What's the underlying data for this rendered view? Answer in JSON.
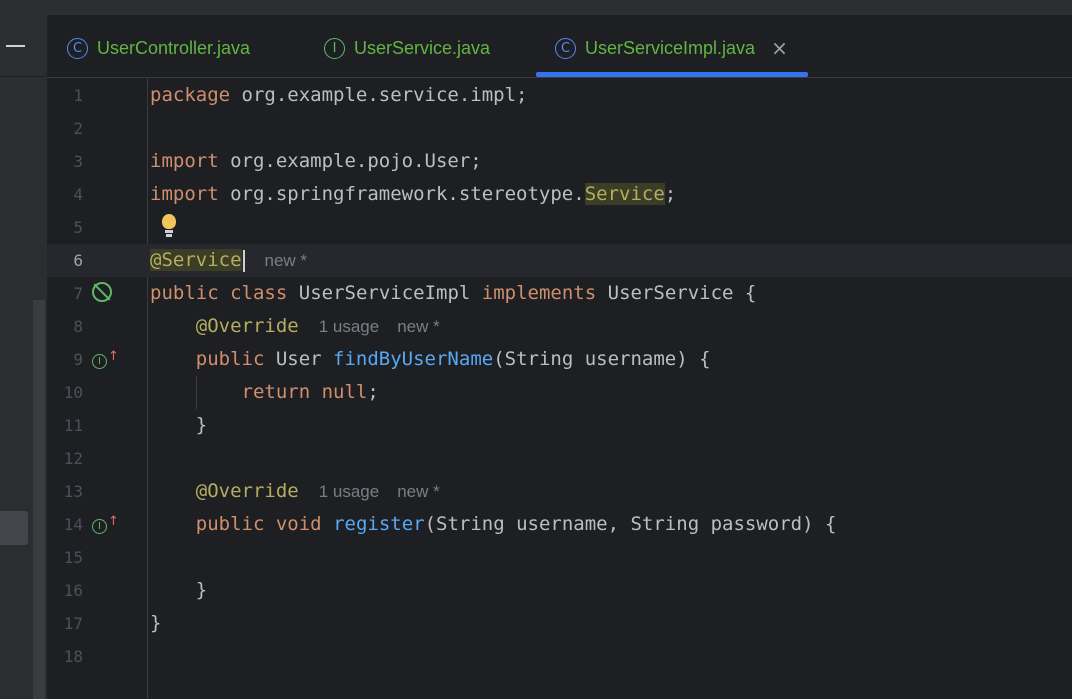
{
  "tabs": [
    {
      "label": "UserController.java",
      "icon": "class-icon",
      "icon_glyph": "C",
      "active": false
    },
    {
      "label": "UserService.java",
      "icon": "interface-icon",
      "icon_glyph": "I",
      "active": false
    },
    {
      "label": "UserServiceImpl.java",
      "icon": "class-icon",
      "icon_glyph": "C",
      "active": true
    }
  ],
  "tab_close_glyph": "×",
  "colors": {
    "accent": "#3574f0",
    "keyword": "#cf8e6d",
    "annotation": "#b3ae60",
    "function": "#56a8f5",
    "text": "#bcbec4",
    "line_number": "#4b5059",
    "file_name": "#62b543"
  },
  "editor": {
    "current_line": 6,
    "line_numbers": [
      "1",
      "2",
      "3",
      "4",
      "5",
      "6",
      "7",
      "8",
      "9",
      "10",
      "11",
      "12",
      "13",
      "14",
      "15",
      "16",
      "17",
      "18"
    ],
    "code": {
      "l1_kw": "package",
      "l1_rest": " org.example.service.impl;",
      "l3_kw": "import",
      "l3_rest": " org.example.pojo.User;",
      "l4_kw": "import",
      "l4_mid": " org.springframework.stereotype.",
      "l4_hl": "Service",
      "l4_end": ";",
      "l6_ann": "@Service",
      "l7_kw1": "public",
      "l7_kw2": "class",
      "l7_name": "UserServiceImpl",
      "l7_kw3": "implements",
      "l7_rest": "UserService {",
      "l8_ann": "@Override",
      "l9_kw": "public",
      "l9_type": " User ",
      "l9_fn": "findByUserName",
      "l9_rest": "(String username) {",
      "l10_kw1": "return",
      "l10_kw2": "null",
      "l10_end": ";",
      "l11": "}",
      "l13_ann": "@Override",
      "l14_kw1": "public",
      "l14_kw2": "void",
      "l14_fn": "register",
      "l14_rest": "(String username, String password) {",
      "l16": "}",
      "l17": "}"
    },
    "hints": {
      "new_star": "new *",
      "one_usage": "1 usage"
    },
    "gutter_icons": {
      "line7": "spring-bean-icon",
      "line9": "implements-method-icon",
      "line14": "implements-method-icon",
      "line5": "lightbulb-icon",
      "impl_glyph": "I",
      "impl_arrow": "↑"
    }
  }
}
